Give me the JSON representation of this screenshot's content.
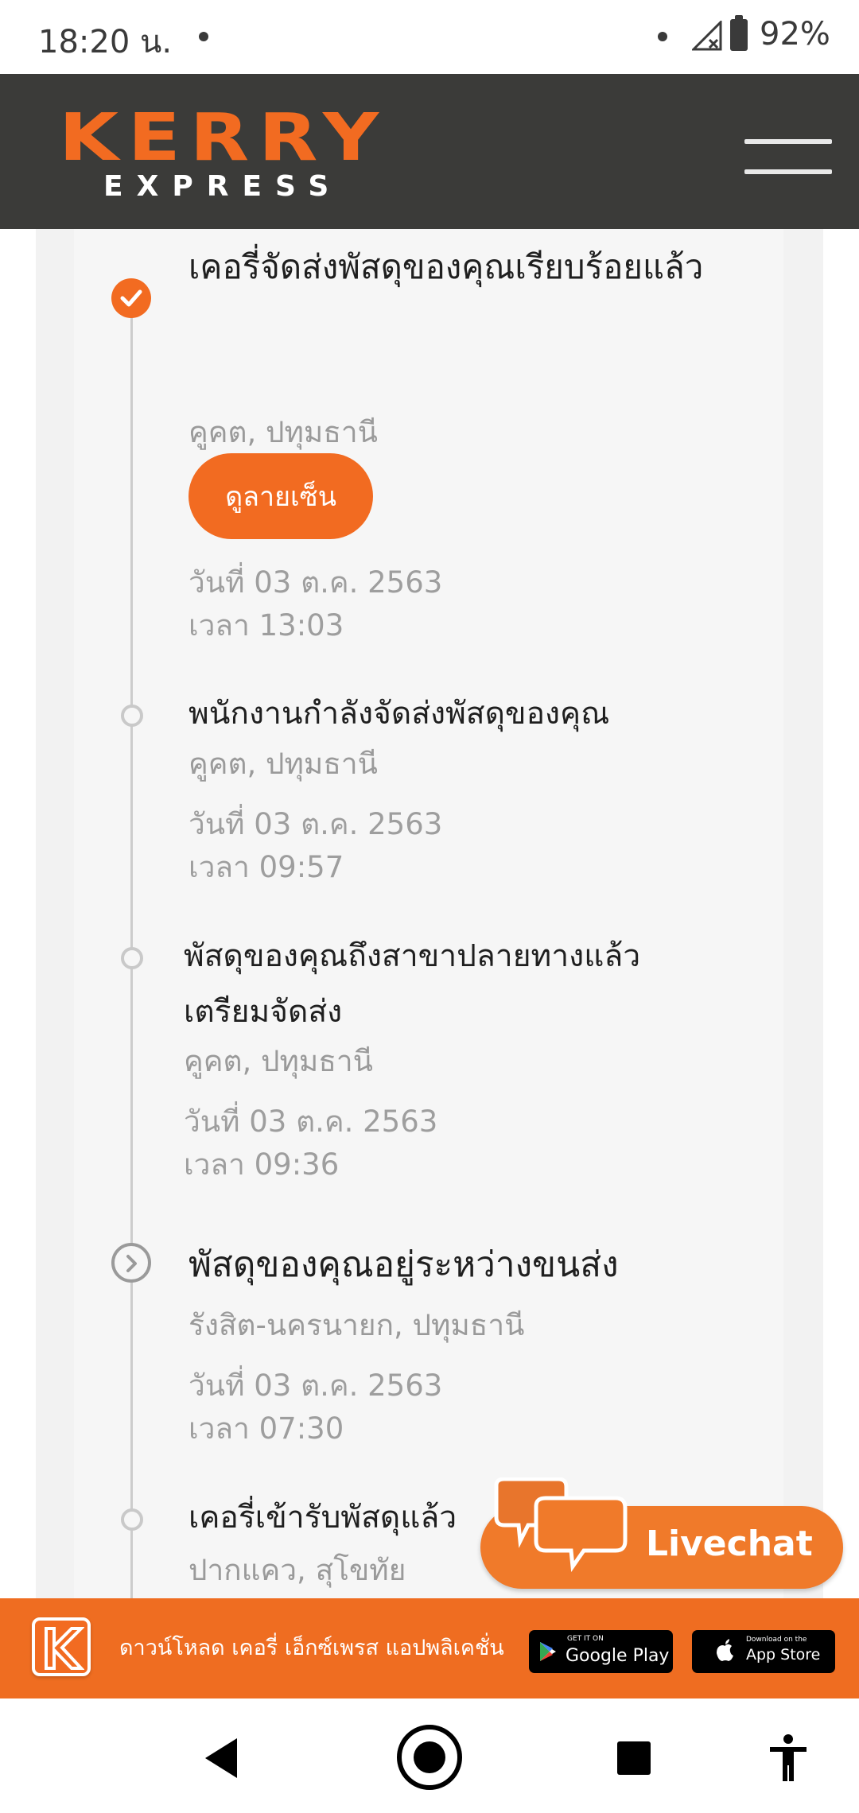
{
  "status_bar": {
    "time": "18:20 น.",
    "battery": "92%"
  },
  "header": {
    "logo_main": "KERRY",
    "logo_sub": "EXPRESS",
    "menu_icon": "hamburger-menu-icon"
  },
  "timeline": {
    "events": [
      {
        "status": "delivered",
        "title": "เคอรี่จัดส่งพัสดุของคุณเรียบร้อยแล้ว",
        "location": "คูคต, ปทุมธานี",
        "button": "ดูลายเซ็น",
        "date": "วันที่ 03 ต.ค. 2563",
        "time": "เวลา 13:03"
      },
      {
        "status": "out-for-delivery",
        "title": "พนักงานกำลังจัดส่งพัสดุของคุณ",
        "location": "คูคต, ปทุมธานี",
        "date": "วันที่ 03 ต.ค. 2563",
        "time": "เวลา 09:57"
      },
      {
        "status": "arrived-at-destination",
        "title": "พัสดุของคุณถึงสาขาปลายทางแล้วเตรียมจัดส่ง",
        "location": "คูคต, ปทุมธานี",
        "date": "วันที่ 03 ต.ค. 2563",
        "time": "เวลา 09:36"
      },
      {
        "status": "in-transit",
        "title": "พัสดุของคุณอยู่ระหว่างขนส่ง",
        "location": "รังสิต-นครนายก, ปทุมธานี",
        "date": "วันที่ 03 ต.ค. 2563",
        "time": "เวลา 07:30"
      },
      {
        "status": "picked-up",
        "title": "เคอรี่เข้ารับพัสดุแล้ว",
        "location": "ปากแคว, สุโขทัย"
      }
    ]
  },
  "livechat": {
    "label": "Livechat"
  },
  "download_banner": {
    "text": "ดาวน์โหลด เคอรี่ เอ็กซ์เพรส แอปพลิเคชั่น",
    "google_play_small": "GET IT ON",
    "google_play_big": "Google Play",
    "app_store_small": "Download on the",
    "app_store_big": "App Store"
  },
  "colors": {
    "brand": "#f26b21",
    "header_bg": "#3b3b39",
    "timeline_bg": "#f6f6f6"
  }
}
